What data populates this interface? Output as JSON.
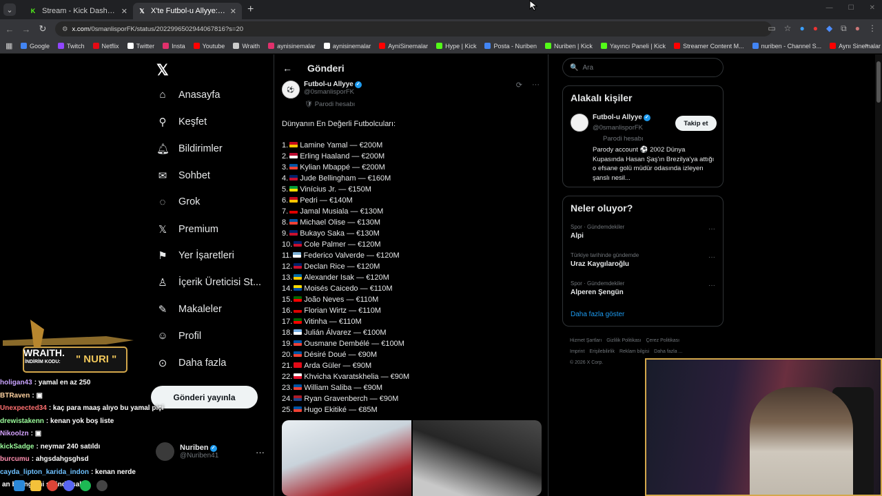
{
  "browser": {
    "tabs": [
      {
        "title": "Stream - Kick Dashboard",
        "icon": "kick-icon",
        "active": false
      },
      {
        "title": "X'te Futbol-u Allyye: \"Dünyanın",
        "icon": "x-icon",
        "active": true
      }
    ],
    "url_domain": "x.com",
    "url_path": "/0smanlisporFK/status/2022996502944067816?s=20",
    "bookmarks": [
      {
        "label": "Google",
        "color": "#4285f4"
      },
      {
        "label": "Twitch",
        "color": "#9146ff"
      },
      {
        "label": "Netflix",
        "color": "#e50914"
      },
      {
        "label": "Twitter",
        "color": "#ffffff"
      },
      {
        "label": "Insta",
        "color": "#e1306c"
      },
      {
        "label": "Youtube",
        "color": "#ff0000"
      },
      {
        "label": "Wraith",
        "color": "#cccccc"
      },
      {
        "label": "aynisinemalar",
        "color": "#e1306c"
      },
      {
        "label": "aynisinemalar",
        "color": "#ffffff"
      },
      {
        "label": "AyniSinemalar",
        "color": "#ff0000"
      },
      {
        "label": "Hype | Kick",
        "color": "#53fc18"
      },
      {
        "label": "Posta - Nuriben",
        "color": "#4285f4"
      },
      {
        "label": "Nuriben | Kick",
        "color": "#53fc18"
      },
      {
        "label": "Yayıncı Paneli | Kick",
        "color": "#53fc18"
      },
      {
        "label": "Streamer Content M...",
        "color": "#ff0000"
      },
      {
        "label": "nuriben - Channel S...",
        "color": "#4285f4"
      },
      {
        "label": "Aynı Sinemalar - Ça...",
        "color": "#ff0000"
      }
    ]
  },
  "nav": {
    "items": [
      {
        "label": "Anasayfa",
        "icon": "home-icon"
      },
      {
        "label": "Keşfet",
        "icon": "search-icon"
      },
      {
        "label": "Bildirimler",
        "icon": "bell-icon"
      },
      {
        "label": "Sohbet",
        "icon": "mail-icon"
      },
      {
        "label": "Grok",
        "icon": "grok-icon"
      },
      {
        "label": "Premium",
        "icon": "x-premium-icon"
      },
      {
        "label": "Yer İşaretleri",
        "icon": "bookmark-icon"
      },
      {
        "label": "İçerik Üreticisi St...",
        "icon": "creator-icon"
      },
      {
        "label": "Makaleler",
        "icon": "article-icon"
      },
      {
        "label": "Profil",
        "icon": "profile-icon"
      },
      {
        "label": "Daha fazla",
        "icon": "more-circle-icon"
      }
    ],
    "post_button": "Gönderi yayınla",
    "account": {
      "name": "Nuriben",
      "handle": "@Nuriben41"
    }
  },
  "main": {
    "header_title": "Gönderi",
    "author": {
      "name": "Futbol-u Allyye",
      "handle": "@0smanlisporFK",
      "badge": "Parodi hesabı"
    },
    "post_intro": "Dünyanın En Değerli Futbolcuları:",
    "players": [
      {
        "rank": "1.",
        "name": "Lamine Yamal",
        "value": "€200M",
        "flag": [
          "#c60b1e",
          "#ffc400"
        ]
      },
      {
        "rank": "2.",
        "name": "Erling Haaland",
        "value": "€200M",
        "flag": [
          "#ba0c2f",
          "#ffffff"
        ]
      },
      {
        "rank": "3.",
        "name": "Kylian Mbappé",
        "value": "€200M",
        "flag": [
          "#0055a4",
          "#ef4135"
        ]
      },
      {
        "rank": "4.",
        "name": "Jude Bellingham",
        "value": "€160M",
        "flag": [
          "#012169",
          "#c8102e"
        ]
      },
      {
        "rank": "5.",
        "name": "Vinícius Jr.",
        "value": "€150M",
        "flag": [
          "#009c3b",
          "#ffdf00"
        ]
      },
      {
        "rank": "6.",
        "name": "Pedri",
        "value": "€140M",
        "flag": [
          "#c60b1e",
          "#ffc400"
        ]
      },
      {
        "rank": "7.",
        "name": "Jamal Musiala",
        "value": "€130M",
        "flag": [
          "#000000",
          "#dd0000"
        ]
      },
      {
        "rank": "8.",
        "name": "Michael Olise",
        "value": "€130M",
        "flag": [
          "#0055a4",
          "#ef4135"
        ]
      },
      {
        "rank": "9.",
        "name": "Bukayo Saka",
        "value": "€130M",
        "flag": [
          "#012169",
          "#c8102e"
        ]
      },
      {
        "rank": "10.",
        "name": "Cole Palmer",
        "value": "€120M",
        "flag": [
          "#012169",
          "#c8102e"
        ]
      },
      {
        "rank": "11.",
        "name": "Federico Valverde",
        "value": "€120M",
        "flag": [
          "#7bafd4",
          "#ffffff"
        ]
      },
      {
        "rank": "12.",
        "name": "Declan Rice",
        "value": "€120M",
        "flag": [
          "#012169",
          "#c8102e"
        ]
      },
      {
        "rank": "13.",
        "name": "Alexander Isak",
        "value": "€120M",
        "flag": [
          "#006aa7",
          "#fecc00"
        ]
      },
      {
        "rank": "14.",
        "name": "Moisés Caicedo",
        "value": "€110M",
        "flag": [
          "#ffdd00",
          "#034ea2"
        ]
      },
      {
        "rank": "15.",
        "name": "João Neves",
        "value": "€110M",
        "flag": [
          "#006600",
          "#ff0000"
        ]
      },
      {
        "rank": "16.",
        "name": "Florian Wirtz",
        "value": "€110M",
        "flag": [
          "#000000",
          "#dd0000"
        ]
      },
      {
        "rank": "17.",
        "name": "Vitinha",
        "value": "€110M",
        "flag": [
          "#006600",
          "#ff0000"
        ]
      },
      {
        "rank": "18.",
        "name": "Julián Álvarez",
        "value": "€100M",
        "flag": [
          "#74acdf",
          "#ffffff"
        ]
      },
      {
        "rank": "19.",
        "name": "Ousmane Dembélé",
        "value": "€100M",
        "flag": [
          "#0055a4",
          "#ef4135"
        ]
      },
      {
        "rank": "20.",
        "name": "Désiré Doué",
        "value": "€90M",
        "flag": [
          "#0055a4",
          "#ef4135"
        ]
      },
      {
        "rank": "21.",
        "name": "Arda Güler",
        "value": "€90M",
        "flag": [
          "#e30a17",
          "#e30a17"
        ]
      },
      {
        "rank": "22.",
        "name": "Khvicha Kvaratskhelia",
        "value": "€90M",
        "flag": [
          "#ffffff",
          "#e8112d"
        ]
      },
      {
        "rank": "23.",
        "name": "William Saliba",
        "value": "€90M",
        "flag": [
          "#0055a4",
          "#ef4135"
        ]
      },
      {
        "rank": "24.",
        "name": "Ryan Gravenberch",
        "value": "€90M",
        "flag": [
          "#ae1c28",
          "#21468b"
        ]
      },
      {
        "rank": "25.",
        "name": "Hugo Ekitiké",
        "value": "€85M",
        "flag": [
          "#0055a4",
          "#ef4135"
        ]
      }
    ]
  },
  "right": {
    "search_placeholder": "Ara",
    "related_title": "Alakalı kişiler",
    "related": {
      "name": "Futbol-u Allyye",
      "handle": "@0smanlisporFK",
      "badge": "Parodi hesabı",
      "bio": "Parody account ⚽ 2002 Dünya Kupasında Hasan Şaş'ın Brezilya'ya attığı o efsane golü müdür odasında izleyen şanslı nesil...",
      "follow_label": "Takip et"
    },
    "trends_title": "Neler oluyor?",
    "trends": [
      {
        "context": "Spor · Gündemdekiler",
        "name": "Alpi"
      },
      {
        "context": "Türkiye tarihinde gündemde",
        "name": "Uraz Kaygılaroğlu"
      },
      {
        "context": "Spor · Gündemdekiler",
        "name": "Alperen Şengün"
      }
    ],
    "show_more": "Daha fazla göster",
    "footer": [
      "Hizmet Şartları",
      "Gizlilik Politikası",
      "Çerez Politikası",
      "Imprint",
      "Erişilebilirlik",
      "Reklam bilgisi",
      "Daha fazla ...",
      "© 2026 X Corp."
    ]
  },
  "overlay": {
    "sponsor_brand": "WRAITH.",
    "sponsor_code_label": "İNDİRİM KODU:",
    "sponsor_code": "\" NURI \"",
    "chat": [
      {
        "user": "holigan43",
        "msg": ": yamal en az 250",
        "color": "#c9a3ff"
      },
      {
        "user": "BTRaven",
        "msg": ": ▣",
        "color": "#ffd2a0"
      },
      {
        "user": "Unexpected34",
        "msg": ": kaç para maaş alıyo bu yamal piçi",
        "color": "#ff7070"
      },
      {
        "user": "drewistakenn",
        "msg": ": kenan yok boş liste",
        "color": "#9dff9d"
      },
      {
        "user": "Nikoolzn",
        "msg": ": ▣",
        "color": "#d6a3ff"
      },
      {
        "user": "kickSadge",
        "msg": ": neymar 240 satıldı",
        "color": "#9dff9d"
      },
      {
        "user": "burcumu",
        "msg": ": ahgsdahgsghsd",
        "color": "#ff8fb0"
      },
      {
        "user": "cayda_lipton_karida_indon",
        "msg": ": kenan nerde",
        "color": "#6ec1ff"
      },
      {
        "user": "",
        "msg": "an belingami sikinde sallar",
        "color": "#ffffff"
      }
    ]
  }
}
